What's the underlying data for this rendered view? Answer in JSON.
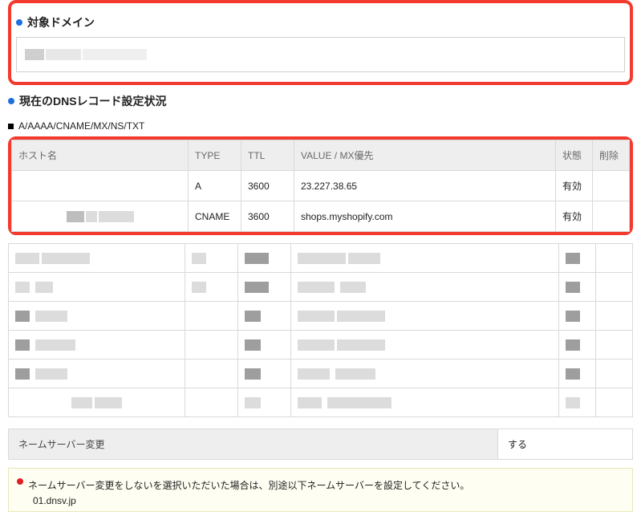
{
  "sections": {
    "target_domain": "対象ドメイン",
    "current_dns": "現在のDNSレコード設定状況",
    "records_subhead": "A/AAAA/CNAME/MX/NS/TXT"
  },
  "table": {
    "headers": {
      "host": "ホスト名",
      "type": "TYPE",
      "ttl": "TTL",
      "value": "VALUE / MX優先",
      "state": "状態",
      "delete": "削除"
    },
    "rows": [
      {
        "host": "",
        "type": "A",
        "ttl": "3600",
        "value": "23.227.38.65",
        "state": "有効"
      },
      {
        "host": "",
        "type": "CNAME",
        "ttl": "3600",
        "value": "shops.myshopify.com",
        "state": "有効"
      }
    ]
  },
  "nameserver": {
    "label": "ネームサーバー変更",
    "action": "する"
  },
  "notice": {
    "text": "ネームサーバー変更をしないを選択いただいた場合は、別途以下ネームサーバーを設定してください。",
    "ns1": "01.dnsv.jp"
  }
}
